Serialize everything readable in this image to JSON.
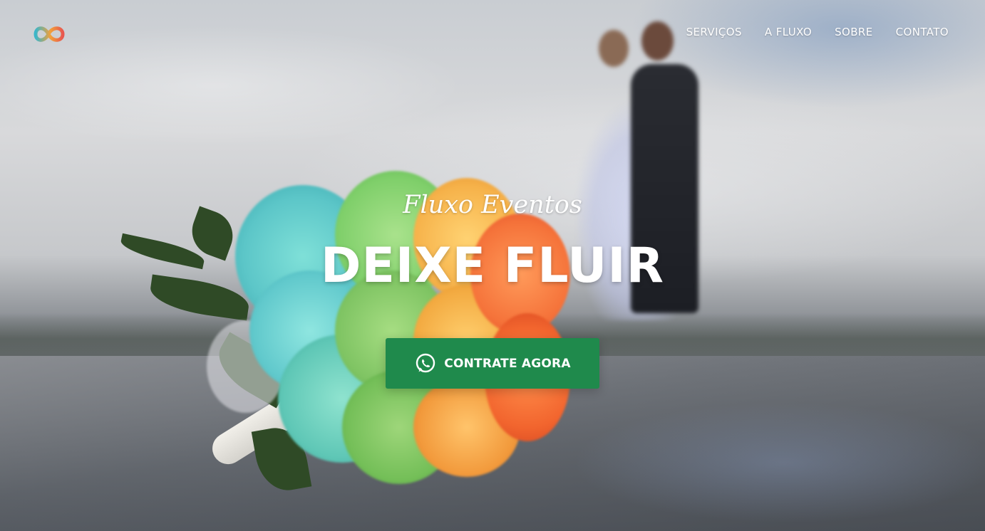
{
  "brand": {
    "logo_icon": "infinity-logo-icon",
    "tagline": "Fluxo Eventos"
  },
  "nav": {
    "items": [
      {
        "label": "SERVIÇOS"
      },
      {
        "label": "A FLUXO"
      },
      {
        "label": "SOBRE"
      },
      {
        "label": "CONTATO"
      }
    ]
  },
  "hero": {
    "headline": "DEIXE FLUIR",
    "cta_label": "CONTRATE AGORA",
    "cta_icon": "whatsapp-icon"
  },
  "colors": {
    "cta_background": "#1f8a4c",
    "text": "#ffffff",
    "logo_gradient": [
      "#3bb6c9",
      "#f2a03a",
      "#e8574f"
    ]
  }
}
